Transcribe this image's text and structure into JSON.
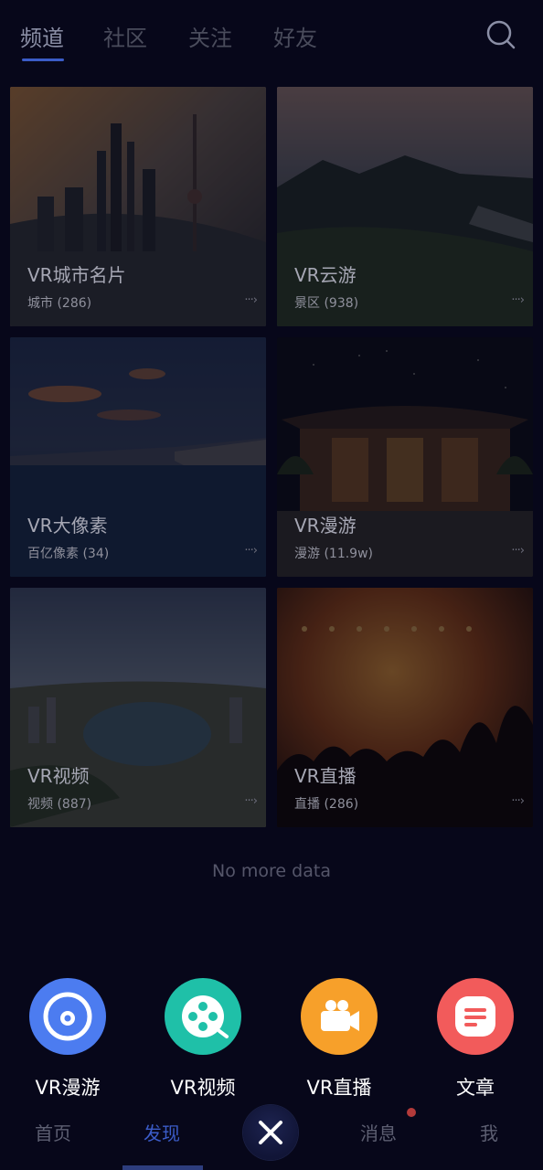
{
  "tabs": [
    {
      "label": "频道",
      "active": true
    },
    {
      "label": "社区",
      "active": false
    },
    {
      "label": "关注",
      "active": false
    },
    {
      "label": "好友",
      "active": false
    }
  ],
  "search_icon": "search-icon",
  "cards": [
    {
      "title": "VR城市名片",
      "sub": "城市 (286)",
      "more": "···›"
    },
    {
      "title": "VR云游",
      "sub": "景区 (938)",
      "more": "···›"
    },
    {
      "title": "VR大像素",
      "sub": "百亿像素 (34)",
      "more": "···›"
    },
    {
      "title": "VR漫游",
      "sub": "漫游 (11.9w)",
      "more": "···›"
    },
    {
      "title": "VR视频",
      "sub": "视频 (887)",
      "more": "···›"
    },
    {
      "title": "VR直播",
      "sub": "直播 (286)",
      "more": "···›"
    }
  ],
  "no_more": "No more data",
  "actions": [
    {
      "label": "VR漫游",
      "icon": "vr-tour-icon",
      "color": "#4c7cf0"
    },
    {
      "label": "VR视频",
      "icon": "film-reel-icon",
      "color": "#1fc0a8"
    },
    {
      "label": "VR直播",
      "icon": "video-camera-icon",
      "color": "#f7a02a"
    },
    {
      "label": "文章",
      "icon": "article-icon",
      "color": "#f25b5b"
    }
  ],
  "nav": [
    {
      "label": "首页",
      "active": false
    },
    {
      "label": "发现",
      "active": true
    },
    {
      "label": "消息",
      "active": false
    },
    {
      "label": "我",
      "active": false
    }
  ],
  "close_icon": "close-icon"
}
